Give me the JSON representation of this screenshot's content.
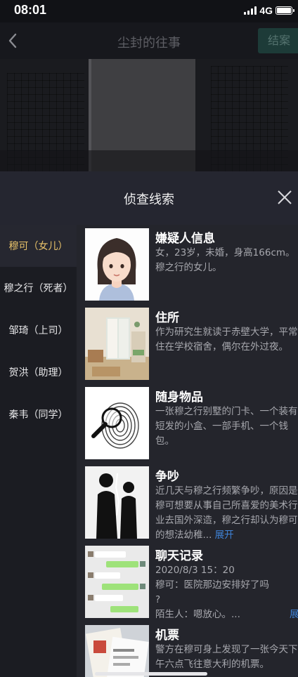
{
  "status": {
    "time": "08:01",
    "network": "4G"
  },
  "nav": {
    "title": "尘封的往事",
    "action": "结案",
    "back_icon": "chevron-left-icon"
  },
  "panel": {
    "title": "侦查线索",
    "close_icon": "close-icon"
  },
  "sidebar": {
    "items": [
      {
        "label": "穆可（女儿）",
        "active": true
      },
      {
        "label": "穆之行（死者）",
        "active": false
      },
      {
        "label": "邹琦（上司）",
        "active": false
      },
      {
        "label": "贺洪（助理）",
        "active": false
      },
      {
        "label": "秦韦（同学）",
        "active": false
      }
    ]
  },
  "clues": [
    {
      "title": "嫌疑人信息",
      "desc": "女，23岁，未婚，身高166cm。穆之行的女儿。",
      "thumb_icon": "girl-portrait"
    },
    {
      "title": "住所",
      "desc": "作为研究生就读于赤壁大学，平常住在学校宿舍，偶尔在外过夜。",
      "thumb_icon": "dorm-room-photo"
    },
    {
      "title": "随身物品",
      "desc": "一张穆之行别墅的门卡、一个装有短发的小盒、一部手机、一个钱包。",
      "thumb_icon": "fingerprint-magnifier"
    },
    {
      "title": "争吵",
      "desc": "近几天与穆之行频繁争吵，原因是穆可想要从事自己所喜爱的美术行业去国外深造，穆之行却认为穆可的想法幼稚...",
      "expand": "展开",
      "thumb_icon": "arguing-silhouettes"
    },
    {
      "title": "聊天记录",
      "lines": [
        "2020/8/3 15：20",
        "穆可：医院那边安排好了吗",
        "?",
        "陌生人：嗯放心。..."
      ],
      "expand": "展开",
      "thumb_icon": "chat-screenshot"
    },
    {
      "title": "机票",
      "desc": "警方在穆可身上发现了一张今天下午六点飞往意大利的机票。",
      "thumb_icon": "plane-ticket-photo"
    }
  ],
  "colors": {
    "accent": "#e9c36a",
    "link": "#3f83d7",
    "panel": "#24252c",
    "sidebar": "#1b1c22"
  }
}
